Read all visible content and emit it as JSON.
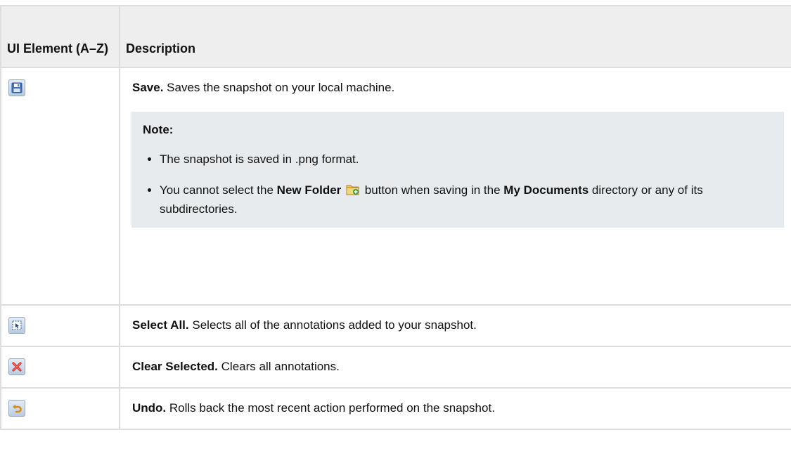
{
  "header": {
    "col1": "UI Element (A–Z)",
    "col2": "Description"
  },
  "rows": [
    {
      "icon": "save-icon",
      "title": "Save.",
      "text": "Saves the snapshot on your local machine.",
      "note": {
        "title": "Note:",
        "items": [
          {
            "text": "The snapshot is saved in .png format."
          },
          {
            "pre": "You cannot select the ",
            "bold1": "New Folder",
            "icon": "new-folder-icon",
            "mid": " button when saving in the ",
            "bold2": "My Documents",
            "post": " directory or any of its subdirectories."
          }
        ]
      }
    },
    {
      "icon": "select-all-icon",
      "title": "Select All.",
      "text": "Selects all of the annotations added to your snapshot."
    },
    {
      "icon": "clear-selected-icon",
      "title": "Clear Selected.",
      "text": "Clears all annotations."
    },
    {
      "icon": "undo-icon",
      "title": "Undo.",
      "text": "Rolls back the most recent action performed on the snapshot."
    }
  ]
}
